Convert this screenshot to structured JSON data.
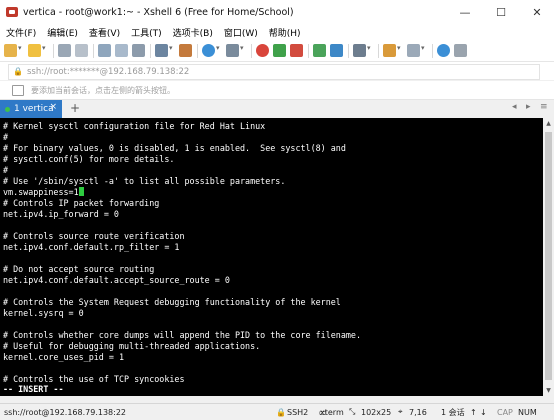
{
  "window": {
    "title": "vertica - root@work1:~ - Xshell 6 (Free for Home/School)",
    "controls": {
      "minimize": "—",
      "maximize": "☐",
      "close": "✕"
    }
  },
  "menu": [
    "文件(F)",
    "编辑(E)",
    "查看(V)",
    "工具(T)",
    "选项卡(B)",
    "窗口(W)",
    "帮助(H)"
  ],
  "address": {
    "value": "ssh://root:*******@192.168.79.138:22"
  },
  "hint": {
    "text": "要添加当前会话，点击左侧的箭头按钮。"
  },
  "tabs": [
    {
      "label": "1 vertica",
      "close": "×",
      "active": true
    }
  ],
  "tab_controls": {
    "add": "+",
    "prev": "◂",
    "next": "▸",
    "menu": "≡"
  },
  "terminal": {
    "lines": [
      "# Kernel sysctl configuration file for Red Hat Linux",
      "#",
      "# For binary values, 0 is disabled, 1 is enabled.  See sysctl(8) and",
      "# sysctl.conf(5) for more details.",
      "#",
      "# Use '/sbin/sysctl -a' to list all possible parameters.",
      "vm.swappiness=1",
      "# Controls IP packet forwarding",
      "net.ipv4.ip_forward = 0",
      "",
      "# Controls source route verification",
      "net.ipv4.conf.default.rp_filter = 1",
      "",
      "# Do not accept source routing",
      "net.ipv4.conf.default.accept_source_route = 0",
      "",
      "# Controls the System Request debugging functionality of the kernel",
      "kernel.sysrq = 0",
      "",
      "# Controls whether core dumps will append the PID to the core filename.",
      "# Useful for debugging multi-threaded applications.",
      "kernel.core_uses_pid = 1",
      "",
      "# Controls the use of TCP syncookies",
      "-- INSERT --"
    ],
    "colors": {
      "bg": "#000000",
      "fg": "#ffffff",
      "cursor": "#2ecc40"
    }
  },
  "status": {
    "connection": "ssh://root@192.168.79.138:22",
    "protocol": "SSH2",
    "term": "xterm",
    "size": "102x25",
    "position": "7,16",
    "sessions": "1 会话",
    "cap": "CAP",
    "num": "NUM"
  },
  "colors": {
    "tab_active": "#2f79c7",
    "accent_green": "#3ec14b"
  }
}
